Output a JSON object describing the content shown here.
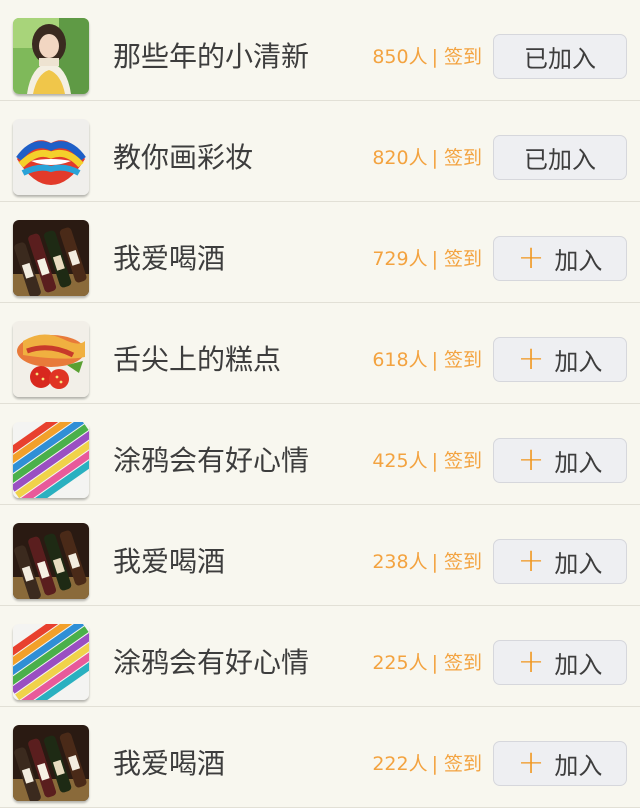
{
  "groups": [
    {
      "name": "那些年的小清新",
      "members": "850人",
      "checkin": "签到",
      "action": "已加入",
      "joined": true,
      "icon": "girl-photo"
    },
    {
      "name": "教你画彩妆",
      "members": "820人",
      "checkin": "签到",
      "action": "已加入",
      "joined": true,
      "icon": "painted-lips-photo"
    },
    {
      "name": "我爱喝酒",
      "members": "729人",
      "checkin": "签到",
      "action": "加入",
      "joined": false,
      "icon": "wine-bottles-photo"
    },
    {
      "name": "舌尖上的糕点",
      "members": "618人",
      "checkin": "签到",
      "action": "加入",
      "joined": false,
      "icon": "pastry-photo"
    },
    {
      "name": "涂鸦会有好心情",
      "members": "425人",
      "checkin": "签到",
      "action": "加入",
      "joined": false,
      "icon": "colored-pencils-photo"
    },
    {
      "name": "我爱喝酒",
      "members": "238人",
      "checkin": "签到",
      "action": "加入",
      "joined": false,
      "icon": "wine-bottles-photo"
    },
    {
      "name": "涂鸦会有好心情",
      "members": "225人",
      "checkin": "签到",
      "action": "加入",
      "joined": false,
      "icon": "colored-pencils-photo"
    },
    {
      "name": "我爱喝酒",
      "members": "222人",
      "checkin": "签到",
      "action": "加入",
      "joined": false,
      "icon": "wine-bottles-photo"
    }
  ],
  "separator": "|",
  "plus_glyph": "+",
  "colors": {
    "accent": "#f0961e",
    "stats": "#f3a340",
    "background": "#f8f7ef",
    "button": "#eeeff2"
  }
}
